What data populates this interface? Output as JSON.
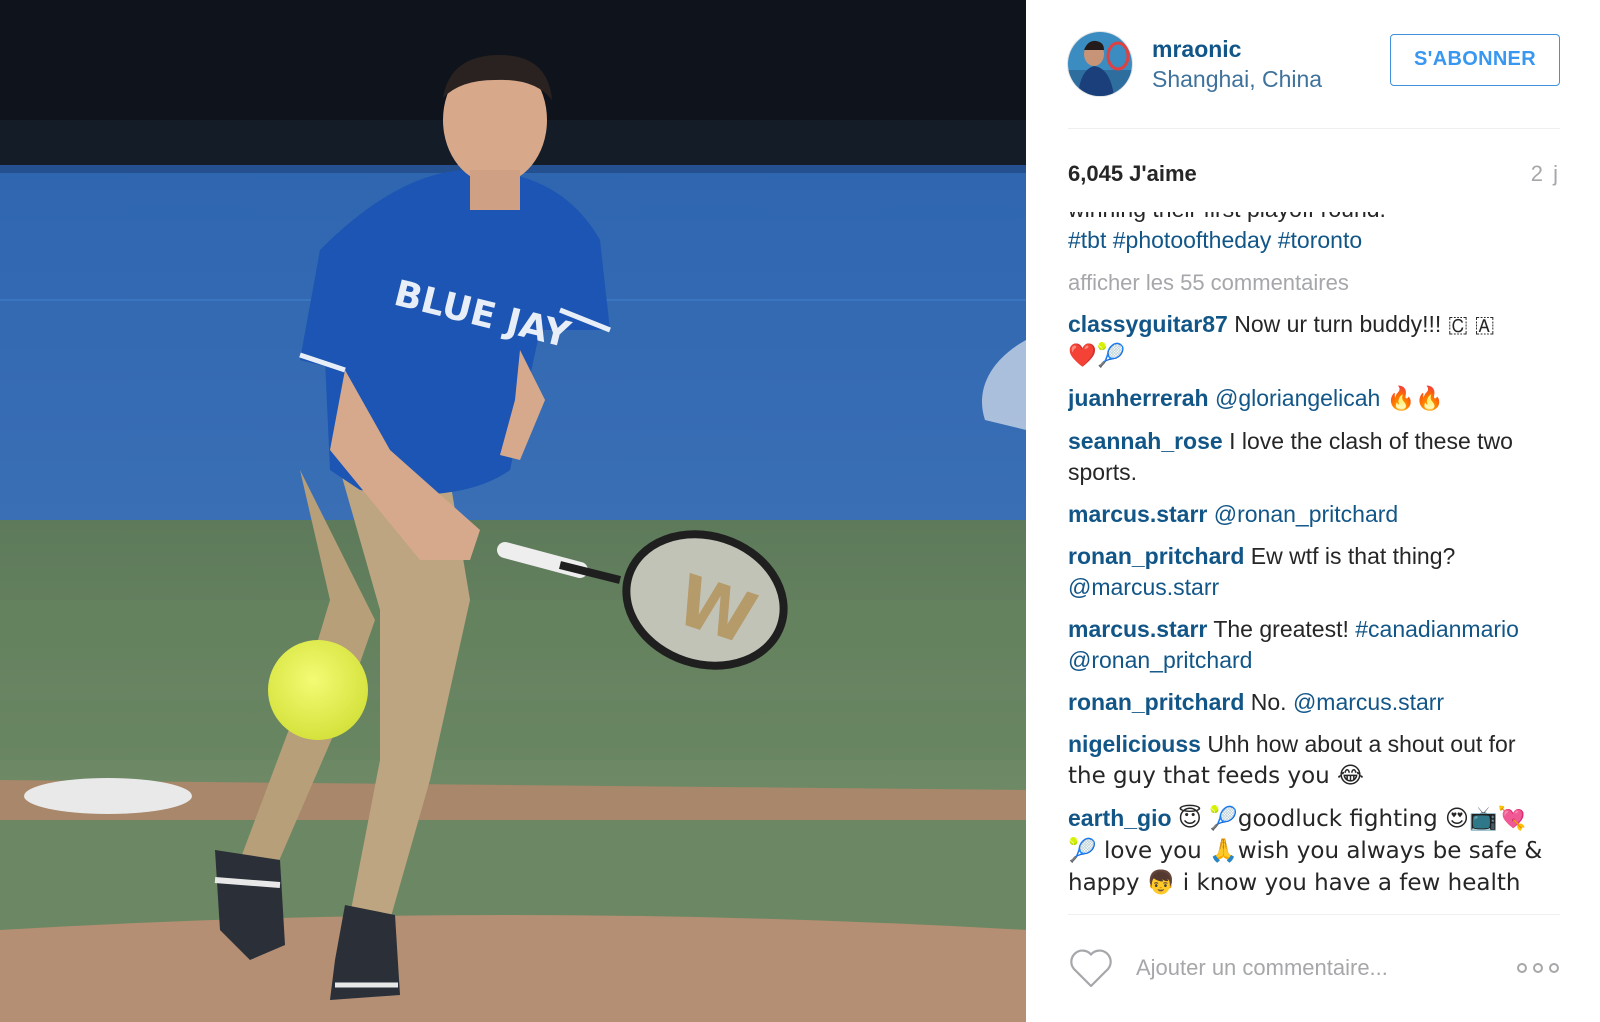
{
  "header": {
    "username": "mraonic",
    "location": "Shanghai, China",
    "follow_label": "S'ABONNER",
    "avatar_icon": "profile-photo"
  },
  "stats": {
    "likes": "6,045 J'aime",
    "age": "2 j"
  },
  "caption": {
    "partial_line": "winning their first playoff round.",
    "hashtags": [
      "#tbt",
      "#photooftheday",
      "#toronto"
    ]
  },
  "view_all_label": "afficher les 55 commentaires",
  "comments": [
    {
      "user": "classyguitar87",
      "text": "Now ur turn buddy!!! 🇨 🇦",
      "line2": "❤️🎾"
    },
    {
      "user": "juanherrerah",
      "mention": "@gloriangelicah",
      "text": "🔥🔥"
    },
    {
      "user": "seannah_rose",
      "text": "I love the clash of these two",
      "line2": "sports."
    },
    {
      "user": "marcus.starr",
      "mention": "@ronan_pritchard"
    },
    {
      "user": "ronan_pritchard",
      "text": "Ew wtf is that thing?",
      "line2_mention": "@marcus.starr"
    },
    {
      "user": "marcus.starr",
      "text": "The greatest!",
      "hashtag": "#canadianmario",
      "line2_mention": "@ronan_pritchard"
    },
    {
      "user": "ronan_pritchard",
      "text": "No.",
      "mention": "@marcus.starr"
    },
    {
      "user": "nigeliciouss",
      "text": "Uhh how about a shout out for",
      "line2": "the guy that feeds you 😂"
    },
    {
      "user": "earth_gio",
      "text": "😇 🎾goodluck fighting 😍📺💘",
      "line2": "🎾 love you 🙏wish you always be safe &",
      "line3": "happy 👦 i know you have a few health"
    }
  ],
  "add_comment": {
    "placeholder": "Ajouter un commentaire...",
    "like_icon": "heart-outline-icon",
    "more_icon": "more-options-icon"
  },
  "colors": {
    "link": "#125688",
    "location": "#3f729b",
    "button": "#3897f0",
    "muted": "#a5a7aa",
    "text": "#262626"
  }
}
